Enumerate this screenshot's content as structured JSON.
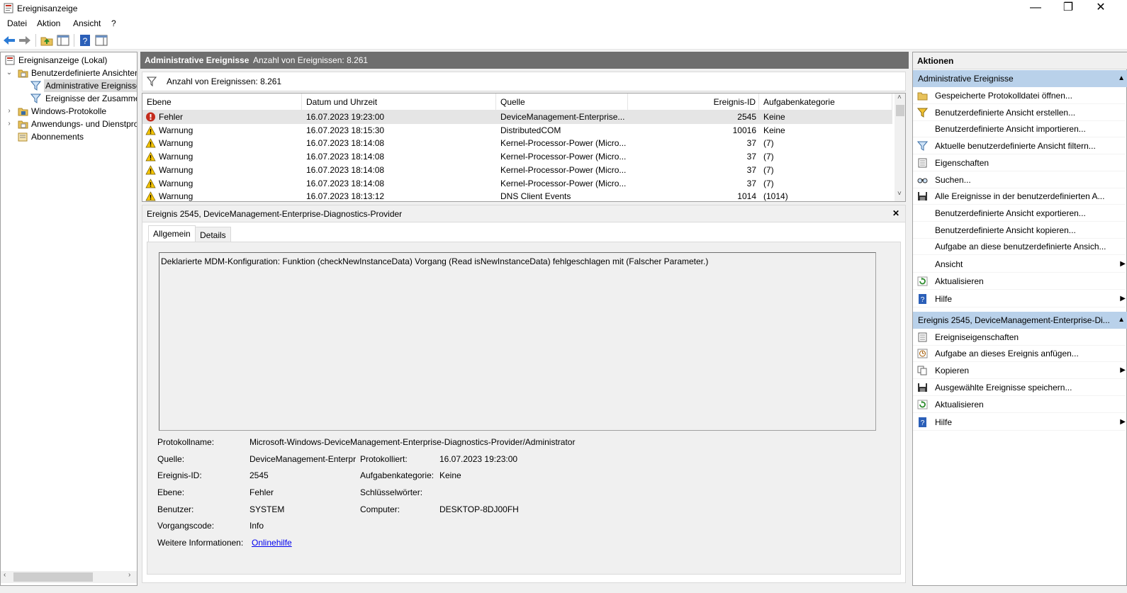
{
  "window": {
    "title": "Ereignisanzeige",
    "controls": {
      "minimize": "—",
      "maximize": "❐",
      "close": "✕"
    }
  },
  "menu": [
    "Datei",
    "Aktion",
    "Ansicht",
    "?"
  ],
  "toolbar": [
    "back-icon",
    "forward-icon",
    "folder-up-icon",
    "show-hide-console-tree-icon",
    "help-icon",
    "show-hide-action-pane-icon"
  ],
  "tree": {
    "items": [
      {
        "label": "Ereignisanzeige (Lokal)",
        "icon": "event-viewer-icon",
        "expander": ""
      },
      {
        "label": "Benutzerdefinierte Ansichten",
        "icon": "folder-icon",
        "expander": "⌄"
      },
      {
        "label": "Administrative Ereignisse",
        "icon": "filter-icon",
        "expander": ""
      },
      {
        "label": "Ereignisse der Zusammenfassung",
        "icon": "filter-icon",
        "expander": ""
      },
      {
        "label": "Windows-Protokolle",
        "icon": "folder-icon",
        "expander": "›"
      },
      {
        "label": "Anwendungs- und Dienstprotokolle",
        "icon": "folder-icon",
        "expander": "›"
      },
      {
        "label": "Abonnements",
        "icon": "subscriptions-icon",
        "expander": ""
      }
    ]
  },
  "center": {
    "header_title": "Administrative Ereignisse",
    "header_count": "Anzahl von Ereignissen: 8.261",
    "filter_text": "Anzahl von Ereignissen: 8.261",
    "columns": [
      "Ebene",
      "Datum und Uhrzeit",
      "Quelle",
      "Ereignis-ID",
      "Aufgabenkategorie"
    ],
    "rows": [
      {
        "level": "Fehler",
        "icon": "error-icon",
        "date": "16.07.2023 19:23:00",
        "source": "DeviceManagement-Enterprise...",
        "id": "2545",
        "category": "Keine"
      },
      {
        "level": "Warnung",
        "icon": "warning-icon",
        "date": "16.07.2023 18:15:30",
        "source": "DistributedCOM",
        "id": "10016",
        "category": "Keine"
      },
      {
        "level": "Warnung",
        "icon": "warning-icon",
        "date": "16.07.2023 18:14:08",
        "source": "Kernel-Processor-Power (Micro...",
        "id": "37",
        "category": "(7)"
      },
      {
        "level": "Warnung",
        "icon": "warning-icon",
        "date": "16.07.2023 18:14:08",
        "source": "Kernel-Processor-Power (Micro...",
        "id": "37",
        "category": "(7)"
      },
      {
        "level": "Warnung",
        "icon": "warning-icon",
        "date": "16.07.2023 18:14:08",
        "source": "Kernel-Processor-Power (Micro...",
        "id": "37",
        "category": "(7)"
      },
      {
        "level": "Warnung",
        "icon": "warning-icon",
        "date": "16.07.2023 18:14:08",
        "source": "Kernel-Processor-Power (Micro...",
        "id": "37",
        "category": "(7)"
      },
      {
        "level": "Warnung",
        "icon": "warning-icon",
        "date": "16.07.2023 18:13:12",
        "source": "DNS Client Events",
        "id": "1014",
        "category": "(1014)"
      }
    ],
    "detail": {
      "title": "Ereignis 2545, DeviceManagement-Enterprise-Diagnostics-Provider",
      "close": "✕",
      "tabs": [
        "Allgemein",
        "Details"
      ],
      "message": "Deklarierte MDM-Konfiguration: Funktion (checkNewInstanceData) Vorgang (Read isNewInstanceData) fehlgeschlagen mit (Falscher Parameter.)",
      "fields": {
        "protokollname_label": "Protokollname:",
        "protokollname": "Microsoft-Windows-DeviceManagement-Enterprise-Diagnostics-Provider/Administrator",
        "quelle_label": "Quelle:",
        "quelle": "DeviceManagement-Enterpr",
        "protokolliert_label": "Protokolliert:",
        "protokolliert": "16.07.2023 19:23:00",
        "ereignisid_label": "Ereignis-ID:",
        "ereignisid": "2545",
        "aufgabenkategorie_label": "Aufgabenkategorie:",
        "aufgabenkategorie": "Keine",
        "ebene_label": "Ebene:",
        "ebene": "Fehler",
        "schluesselwoerter_label": "Schlüsselwörter:",
        "schluesselwoerter": "",
        "benutzer_label": "Benutzer:",
        "benutzer": "SYSTEM",
        "computer_label": "Computer:",
        "computer": "DESKTOP-8DJ00FH",
        "vorgangscode_label": "Vorgangscode:",
        "vorgangscode": "Info",
        "weitere_label": "Weitere Informationen:",
        "weitere_link": "Onlinehilfe"
      }
    }
  },
  "actions": {
    "header": "Aktionen",
    "section1": {
      "title": "Administrative Ereignisse",
      "items": [
        {
          "label": "Gespeicherte Protokolldatei öffnen...",
          "icon": "open-log-icon"
        },
        {
          "label": "Benutzerdefinierte Ansicht erstellen...",
          "icon": "create-view-icon"
        },
        {
          "label": "Benutzerdefinierte Ansicht importieren...",
          "icon": ""
        },
        {
          "label": "Aktuelle benutzerdefinierte Ansicht filtern...",
          "icon": "filter-icon"
        },
        {
          "label": "Eigenschaften",
          "icon": "properties-icon"
        },
        {
          "label": "Suchen...",
          "icon": "find-icon"
        },
        {
          "label": "Alle Ereignisse in der benutzerdefinierten A...",
          "icon": "save-icon"
        },
        {
          "label": "Benutzerdefinierte Ansicht exportieren...",
          "icon": ""
        },
        {
          "label": "Benutzerdefinierte Ansicht kopieren...",
          "icon": ""
        },
        {
          "label": "Aufgabe an diese benutzerdefinierte Ansich...",
          "icon": ""
        },
        {
          "label": "Ansicht",
          "icon": "",
          "submenu": "▶"
        },
        {
          "label": "Aktualisieren",
          "icon": "refresh-icon"
        },
        {
          "label": "Hilfe",
          "icon": "help-icon",
          "submenu": "▶"
        }
      ]
    },
    "section2": {
      "title": "Ereignis 2545, DeviceManagement-Enterprise-Di...",
      "items": [
        {
          "label": "Ereigniseigenschaften",
          "icon": "event-properties-icon"
        },
        {
          "label": "Aufgabe an dieses Ereignis anfügen...",
          "icon": "attach-task-icon"
        },
        {
          "label": "Kopieren",
          "icon": "copy-icon",
          "submenu": "▶"
        },
        {
          "label": "Ausgewählte Ereignisse speichern...",
          "icon": "save-icon"
        },
        {
          "label": "Aktualisieren",
          "icon": "refresh-icon"
        },
        {
          "label": "Hilfe",
          "icon": "help-icon",
          "submenu": "▶"
        }
      ]
    }
  },
  "colors": {
    "selection": "#e5e5e5",
    "section_header": "#b9d1ea",
    "center_header": "#6e6e6e",
    "link": "#0000ee",
    "error": "#c42b1c",
    "warning": "#f7c600"
  }
}
